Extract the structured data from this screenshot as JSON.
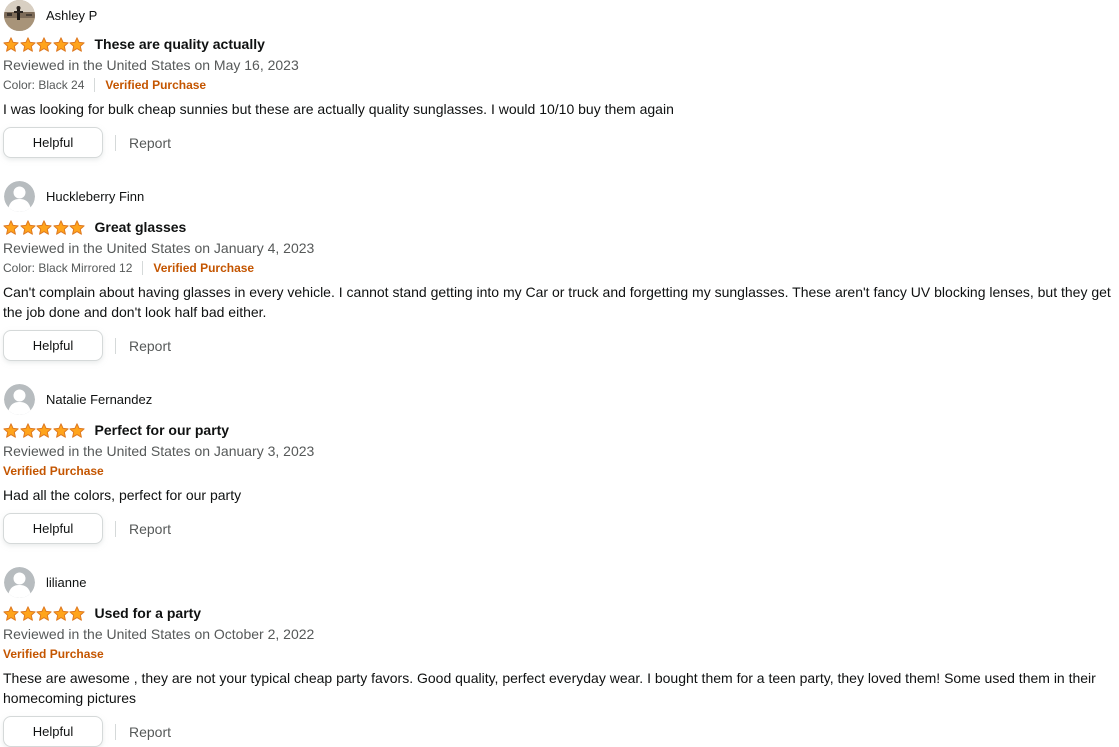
{
  "colors": {
    "star": "#ffa41c",
    "verified": "#c45500",
    "secondary_text": "#565959"
  },
  "reviews": [
    {
      "reviewer": "Ashley P",
      "avatar": "photo-avatar",
      "rating": 5,
      "title": "These are quality actually",
      "date": "Reviewed in the United States on May 16, 2023",
      "variant": "Color: Black 24",
      "verified": "Verified Purchase",
      "body": "I was looking for bulk cheap sunnies but these are actually quality sunglasses. I would 10/10 buy them again",
      "helpful": "Helpful",
      "report": "Report"
    },
    {
      "reviewer": "Huckleberry Finn",
      "avatar": "default-user-icon",
      "rating": 5,
      "title": "Great glasses",
      "date": "Reviewed in the United States on January 4, 2023",
      "variant": "Color: Black Mirrored 12",
      "verified": "Verified Purchase",
      "body": "Can't complain about having glasses in every vehicle. I cannot stand getting into my Car or truck and forgetting my sunglasses. These aren't fancy UV blocking lenses, but they get the job done and don't look half bad either.",
      "helpful": "Helpful",
      "report": "Report"
    },
    {
      "reviewer": "Natalie Fernandez",
      "avatar": "default-user-icon",
      "rating": 5,
      "title": "Perfect for our party",
      "date": "Reviewed in the United States on January 3, 2023",
      "verified": "Verified Purchase",
      "body": "Had all the colors, perfect for our party",
      "helpful": "Helpful",
      "report": "Report"
    },
    {
      "reviewer": "lilianne",
      "avatar": "default-user-icon",
      "rating": 5,
      "title": "Used for a party",
      "date": "Reviewed in the United States on October 2, 2022",
      "verified": "Verified Purchase",
      "body": "These are awesome , they are not your typical cheap party favors. Good quality, perfect everyday wear. I bought them for a teen party, they loved them! Some used them in their homecoming pictures",
      "helpful": "Helpful",
      "report": "Report"
    }
  ]
}
